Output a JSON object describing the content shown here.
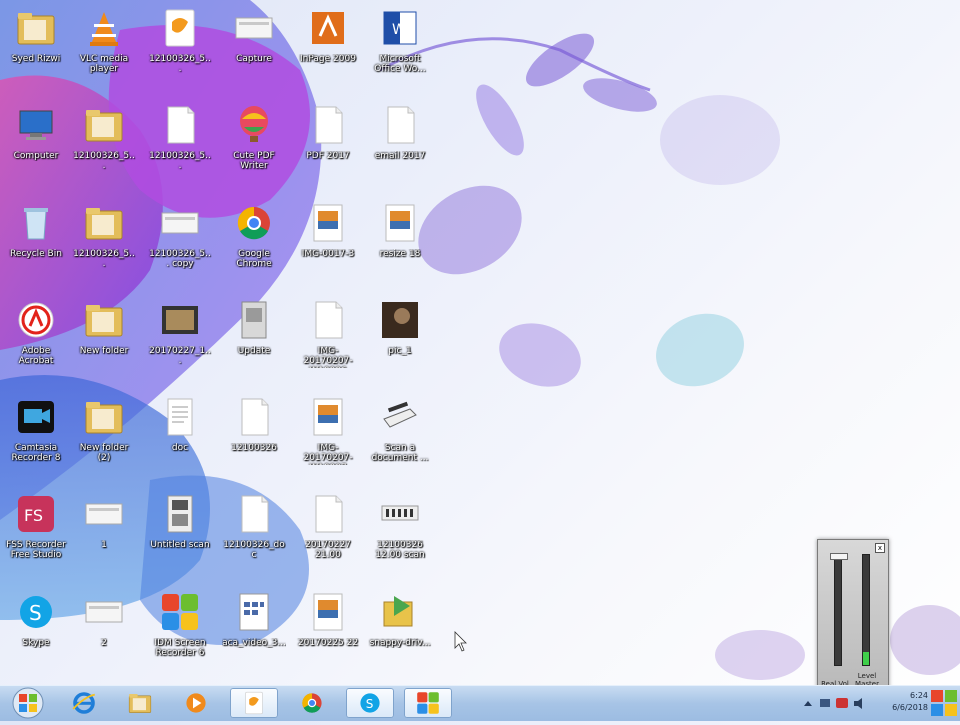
{
  "desktop": {
    "icons": [
      {
        "label": "Syed Rizwi",
        "type": "folder",
        "col": 0,
        "row": 0
      },
      {
        "label": "VLC media player",
        "type": "vlc",
        "col": 1,
        "row": 0
      },
      {
        "label": "12100326_5...",
        "type": "zip",
        "col": 2,
        "row": 0
      },
      {
        "label": "Capture",
        "type": "image-strip",
        "col": 3,
        "row": 0
      },
      {
        "label": "InPage 2009",
        "type": "inpage",
        "col": 4,
        "row": 0
      },
      {
        "label": "Microsoft Office Wo...",
        "type": "word",
        "col": 5,
        "row": 0
      },
      {
        "label": "Computer",
        "type": "computer",
        "col": 0,
        "row": 1
      },
      {
        "label": "12100326_5...",
        "type": "folder",
        "col": 1,
        "row": 1
      },
      {
        "label": "12100326_5...",
        "type": "doc",
        "col": 2,
        "row": 1
      },
      {
        "label": "Cute PDF Writer",
        "type": "balloon",
        "col": 3,
        "row": 1
      },
      {
        "label": "PDF 2017",
        "type": "doc",
        "col": 4,
        "row": 1
      },
      {
        "label": "email 2017",
        "type": "doc",
        "col": 5,
        "row": 1
      },
      {
        "label": "Recycle Bin",
        "type": "recycle",
        "col": 0,
        "row": 2
      },
      {
        "label": "12100326_5...",
        "type": "folder",
        "col": 1,
        "row": 2
      },
      {
        "label": "12100326_5... copy",
        "type": "image-strip",
        "col": 2,
        "row": 2
      },
      {
        "label": "Google Chrome",
        "type": "chrome",
        "col": 3,
        "row": 2
      },
      {
        "label": "IMG-0017-3",
        "type": "pic",
        "col": 4,
        "row": 2
      },
      {
        "label": "resize 18",
        "type": "pic",
        "col": 5,
        "row": 2
      },
      {
        "label": "Adobe Acrobat",
        "type": "acrobat",
        "col": 0,
        "row": 3
      },
      {
        "label": "New folder",
        "type": "folder",
        "col": 1,
        "row": 3
      },
      {
        "label": "20170227_1...",
        "type": "photo",
        "col": 2,
        "row": 3
      },
      {
        "label": "Update",
        "type": "grey-doc",
        "col": 3,
        "row": 3
      },
      {
        "label": "IMG-20170207-WA0006",
        "type": "doc",
        "col": 4,
        "row": 3
      },
      {
        "label": "pic_1",
        "type": "dark-photo",
        "col": 5,
        "row": 3
      },
      {
        "label": "Camtasia Recorder 8",
        "type": "camtasia",
        "col": 0,
        "row": 4
      },
      {
        "label": "New folder (2)",
        "type": "folder",
        "col": 1,
        "row": 4
      },
      {
        "label": "doc",
        "type": "doc-lines",
        "col": 2,
        "row": 4
      },
      {
        "label": "12100326",
        "type": "doc",
        "col": 3,
        "row": 4
      },
      {
        "label": "IMG-20170207-WA0007",
        "type": "pic",
        "col": 4,
        "row": 4
      },
      {
        "label": "Scan a document ...",
        "type": "scanner",
        "col": 5,
        "row": 4
      },
      {
        "label": "FSS Recorder Free Studio",
        "type": "fs",
        "col": 0,
        "row": 5
      },
      {
        "label": "1",
        "type": "image-strip",
        "col": 1,
        "row": 5
      },
      {
        "label": "Untitled scan",
        "type": "scan",
        "col": 2,
        "row": 5
      },
      {
        "label": "12100326_doc",
        "type": "doc",
        "col": 3,
        "row": 5
      },
      {
        "label": "20170227 21.00",
        "type": "doc",
        "col": 4,
        "row": 5
      },
      {
        "label": "12100326 12.00 scan",
        "type": "scan-strip",
        "col": 5,
        "row": 5
      },
      {
        "label": "Skype",
        "type": "skype",
        "col": 0,
        "row": 6
      },
      {
        "label": "2",
        "type": "image-strip",
        "col": 1,
        "row": 6
      },
      {
        "label": "IDM Screen Recorder 6",
        "type": "idm",
        "col": 2,
        "row": 6
      },
      {
        "label": "aca_video_3...",
        "type": "calendar-doc",
        "col": 3,
        "row": 6
      },
      {
        "label": "20170225 22",
        "type": "pic",
        "col": 4,
        "row": 6
      },
      {
        "label": "snappy-driv...",
        "type": "installer",
        "col": 5,
        "row": 6
      }
    ]
  },
  "mixer": {
    "left_label": "Real Vol",
    "right_label": "Level Master",
    "left_level": 0.0,
    "right_level": 0.12,
    "close": "x"
  },
  "taskbar": {
    "start_icon": "windows-orb-icon",
    "pinned": [
      {
        "name": "internet-explorer",
        "icon": "ie-icon",
        "active": false
      },
      {
        "name": "file-explorer",
        "icon": "folder-icon",
        "active": false
      },
      {
        "name": "media-player",
        "icon": "media-player-icon",
        "active": false
      },
      {
        "name": "zip-app",
        "icon": "zip-icon",
        "active": true
      },
      {
        "name": "chrome",
        "icon": "chrome-icon",
        "active": false
      },
      {
        "name": "skype",
        "icon": "skype-icon",
        "active": true
      },
      {
        "name": "idm",
        "icon": "idm-icon",
        "active": true
      }
    ],
    "clock": {
      "time": "6:24",
      "date": "6/6/2018"
    }
  },
  "colors": {
    "accent_purple": "#a36bd9",
    "taskbar": "#a7c4e6",
    "level_green": "#3fcf4a"
  }
}
